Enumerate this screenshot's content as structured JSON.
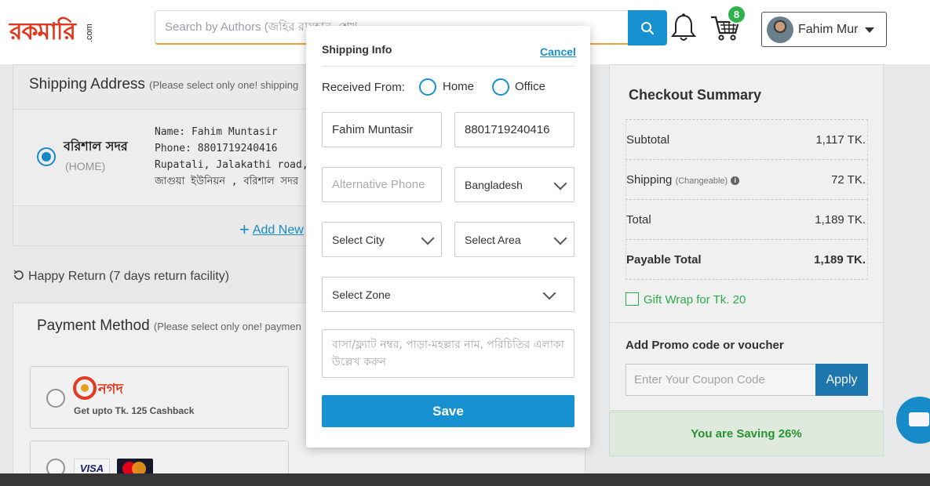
{
  "header": {
    "logo_main": "রকমারি",
    "logo_sub": ".com",
    "search_placeholder": "Search by Authors (জহির রায়হান, শেখ",
    "cart_count": "8",
    "user_name": "Fahim Mur"
  },
  "shipping": {
    "title": "Shipping Address",
    "subtitle": "(Please select only one! shipping",
    "address_name": "বরিশাল সদর",
    "address_tag": "(HOME)",
    "line1": "Name: Fahim Muntasir",
    "line2": "Phone: 8801719240416",
    "line3": "Rupatali, Jalakathi road, Barish",
    "line4": "জাগুয়া ইউনিয়ন , বরিশাল সদর ,",
    "add_new": "Add New"
  },
  "happy_return": "Happy Return (7 days return facility)",
  "payment": {
    "title": "Payment Method",
    "subtitle": "(Please select only one! paymen",
    "nagad_name": "নগদ",
    "nagad_offer": "Get upto Tk. 125 Cashback",
    "visa_label": "VISA"
  },
  "summary": {
    "title": "Checkout Summary",
    "rows": [
      {
        "label": "Subtotal",
        "note": "",
        "value": "1,117 TK."
      },
      {
        "label": "Shipping",
        "note": "(Changeable)",
        "value": "72 TK."
      },
      {
        "label": "Total",
        "note": "",
        "value": "1,189 TK."
      },
      {
        "label": "Payable Total",
        "note": "",
        "value": "1,189 TK."
      }
    ],
    "gift_wrap": "Gift Wrap for Tk. 20",
    "promo_title": "Add Promo code or voucher",
    "coupon_placeholder": "Enter Your Coupon Code",
    "apply_label": "Apply",
    "saving": "You are Saving 26%"
  },
  "modal": {
    "title": "Shipping Info",
    "cancel": "Cancel",
    "received_from": "Received From:",
    "opt_home": "Home",
    "opt_office": "Office",
    "name_value": "Fahim Muntasir",
    "phone_value": "8801719240416",
    "alt_phone_placeholder": "Alternative Phone",
    "country": "Bangladesh",
    "city": "Select City",
    "area": "Select Area",
    "zone": "Select Zone",
    "address_placeholder": "বাসা/ফ্ল্যাট নম্বর, পাড়া-মহল্লার নাম, পরিচিতির এলাকা উল্লেখ করুন",
    "save": "Save"
  },
  "colors": {
    "accent": "#1791d0",
    "brand": "#e0381e",
    "success": "#2fb24c"
  }
}
